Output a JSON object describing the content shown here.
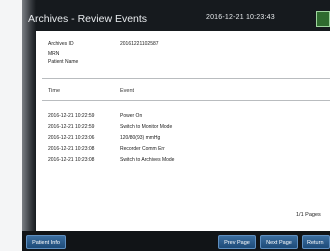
{
  "header": {
    "title": "Archives - Review Events",
    "datetime": "2016-12-21 10:23:43"
  },
  "patient": {
    "archives_id_label": "Archives ID",
    "archives_id_value": "20161221102587",
    "mrn_label": "MRN",
    "name_label": "Patient Name"
  },
  "events": {
    "columns": [
      "Time",
      "Event"
    ],
    "rows": [
      {
        "time": "2016-12-21 10:22:59",
        "event": "Power On"
      },
      {
        "time": "2016-12-21 10:22:59",
        "event": "Switch to Monitor Mode"
      },
      {
        "time": "2016-12-21 10:23:06",
        "event": "120/80(93) mmHg"
      },
      {
        "time": "2016-12-21 10:23:08",
        "event": "Recorder Comm Err"
      },
      {
        "time": "2016-12-21 10:23:08",
        "event": "Switch to Archives Mode"
      }
    ]
  },
  "pagination": {
    "text": "1/1 Pages"
  },
  "footer": {
    "patient_info": "Patient Info",
    "prev_page": "Prev Page",
    "next_page": "Next Page",
    "return": "Return"
  },
  "colors": {
    "bezel": "#161a1e",
    "button": "#2a5a8c",
    "content_bg": "#ffffff"
  }
}
